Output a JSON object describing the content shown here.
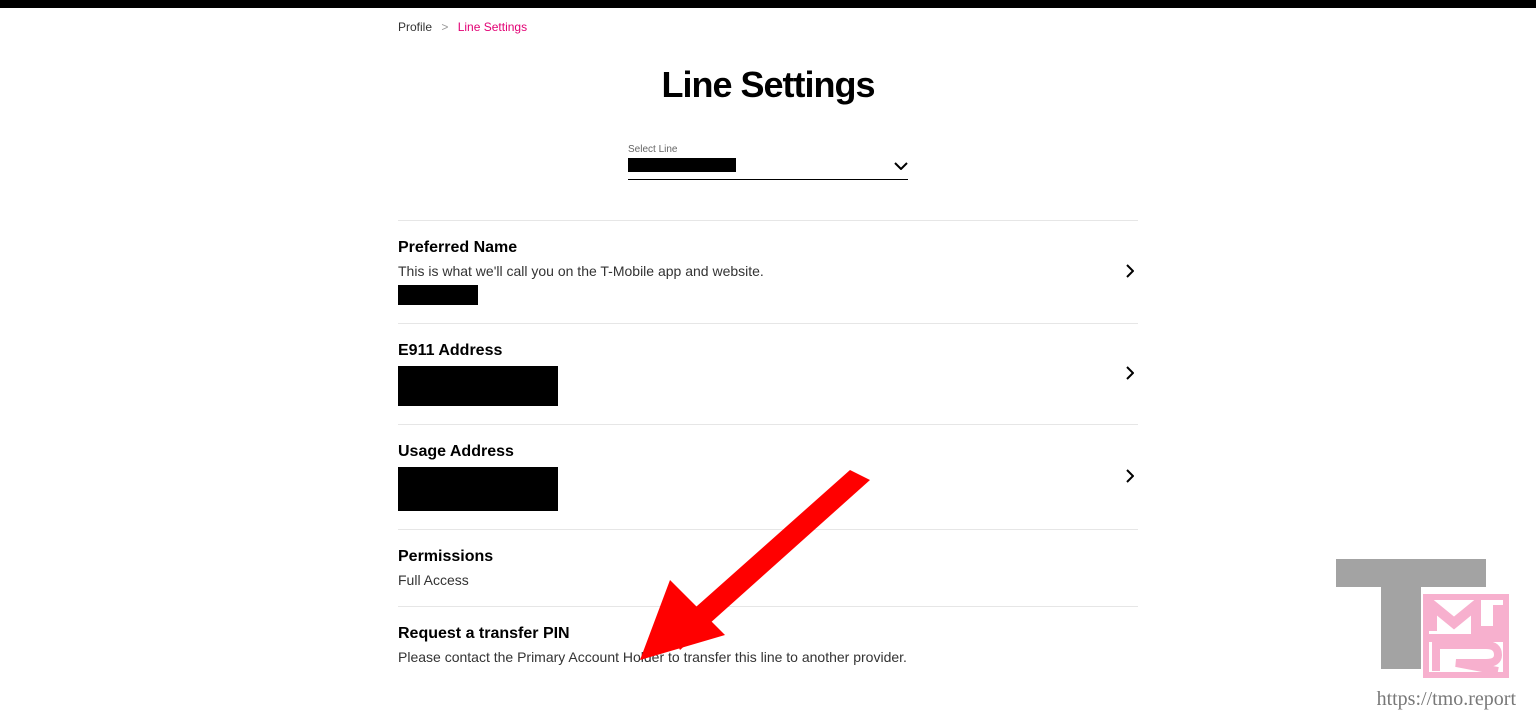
{
  "breadcrumb": {
    "root": "Profile",
    "current": "Line Settings"
  },
  "page_title": "Line Settings",
  "select_line": {
    "label": "Select Line"
  },
  "rows": {
    "preferred_name": {
      "title": "Preferred Name",
      "desc": "This is what we'll call you on the T-Mobile app and website."
    },
    "e911": {
      "title": "E911 Address"
    },
    "usage": {
      "title": "Usage Address"
    },
    "permissions": {
      "title": "Permissions",
      "value": "Full Access"
    },
    "transfer_pin": {
      "title": "Request a transfer PIN",
      "desc": "Please contact the Primary Account Holder to transfer this line to another provider."
    }
  },
  "watermark_url": "https://tmo.report"
}
